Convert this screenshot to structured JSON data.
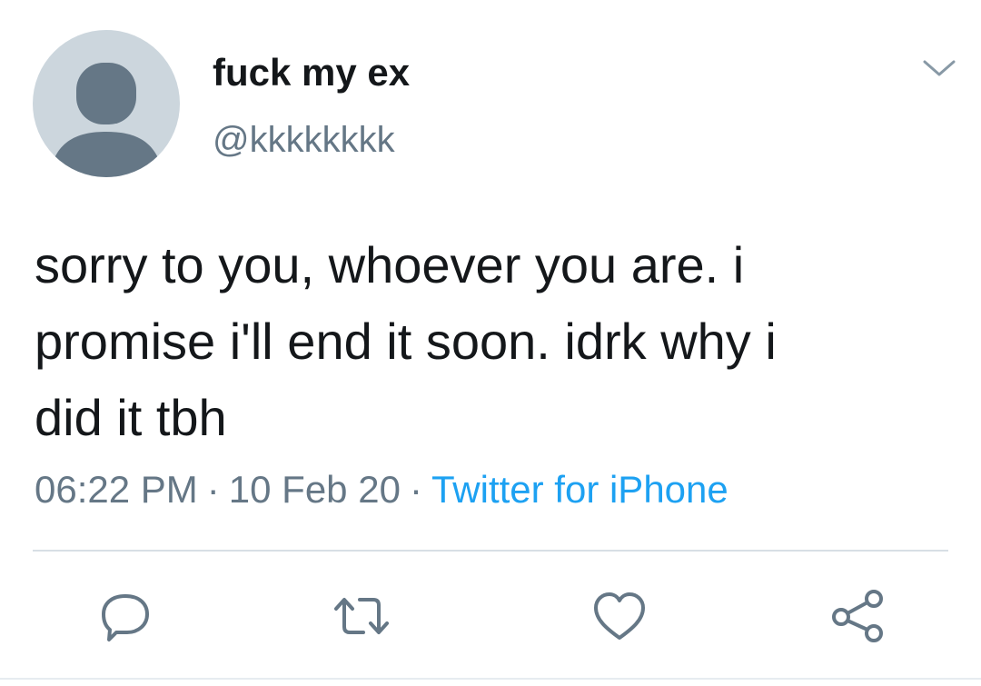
{
  "tweet": {
    "author": {
      "display_name": "fuck my ex",
      "handle": "@kkkkkkkk",
      "avatar_icon": "default-avatar-icon"
    },
    "text_lines": [
      "sorry to you, whoever you are. i",
      "promise i'll end it soon. idrk why i",
      "did it tbh"
    ],
    "time": "06:22 PM",
    "date": "10 Feb 20",
    "separator": "·",
    "source": "Twitter for iPhone",
    "menu_icon": "chevron-down-icon",
    "actions": [
      {
        "name": "reply",
        "icon": "speech-bubble-icon"
      },
      {
        "name": "retweet",
        "icon": "retweet-icon"
      },
      {
        "name": "like",
        "icon": "heart-icon"
      },
      {
        "name": "share",
        "icon": "share-icon"
      }
    ]
  },
  "colors": {
    "text_primary": "#14171a",
    "text_secondary": "#657786",
    "link": "#1da1f2",
    "avatar_bg": "#ccd6dd",
    "avatar_fg": "#657786",
    "divider": "#d8dfe5"
  }
}
